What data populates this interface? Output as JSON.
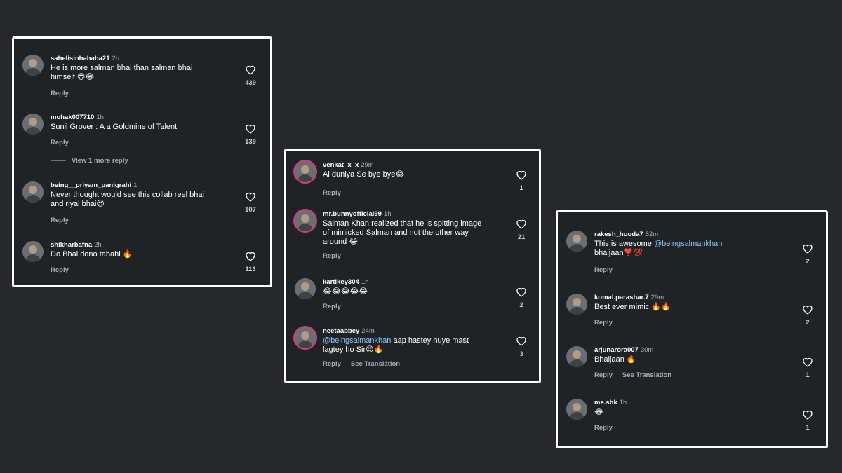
{
  "panels": [
    {
      "comments": [
        {
          "username": "sahelisinhahaha21",
          "time": "2h",
          "text": "He is more salman bhai than salman bhai himself 😍😂",
          "reply": "Reply",
          "likes": "439"
        },
        {
          "username": "mohak007710",
          "time": "1h",
          "text": "Sunil Grover : A a Goldmine of Talent",
          "reply": "Reply",
          "likes": "139",
          "more_replies": "View 1 more reply"
        },
        {
          "username": "being__priyam_panigrahi",
          "time": "1h",
          "text": "Never thought would see this collab reel bhai and riyal bhai😍",
          "reply": "Reply",
          "likes": "107"
        },
        {
          "username": "shikharbafna",
          "time": "2h",
          "text": "Do Bhai dono tabahi 🔥",
          "reply": "Reply",
          "likes": "113"
        }
      ]
    },
    {
      "comments": [
        {
          "username": "venkat_x_x",
          "time": "29m",
          "text": "Al duniya Se bye bye😂",
          "reply": "Reply",
          "likes": "1"
        },
        {
          "username": "mr.bunnyofficial99",
          "time": "1h",
          "text": "Salman Khan realized that he is spitting image of mimicked Salman and not the other way around 😂",
          "reply": "Reply",
          "likes": "21"
        },
        {
          "username": "kartikey304",
          "time": "1h",
          "text": "😂😂😂😂😂",
          "reply": "Reply",
          "likes": "2"
        },
        {
          "username": "neetaabbey",
          "time": "24m",
          "mention": "@beingsalmankhan",
          "text": " aap hastey huye mast lagtey ho Sir😍🔥",
          "reply": "Reply",
          "see_translation": "See Translation",
          "likes": "3"
        }
      ]
    },
    {
      "comments": [
        {
          "username": "rakesh_hooda7",
          "time": "52m",
          "text": "This is awesome ",
          "mention": "@beingsalmankhan",
          "text_after": " bhaijaan❣️💯",
          "reply": "Reply",
          "likes": "2"
        },
        {
          "username": "komal.parashar.7",
          "time": "29m",
          "text": "Best ever mimic 🔥🔥",
          "reply": "Reply",
          "likes": "2"
        },
        {
          "username": "arjunarora007",
          "time": "30m",
          "text": "Bhaijaan 🔥",
          "reply": "Reply",
          "see_translation": "See Translation",
          "likes": "1"
        },
        {
          "username": "me.sbk",
          "time": "1h",
          "text": "😂",
          "reply": "Reply",
          "likes": "1"
        }
      ]
    }
  ],
  "icons": {
    "like": "heart-outline-icon",
    "avatar": "user-avatar"
  },
  "colors": {
    "background": "#26282b",
    "panel": "#1f2326",
    "mention": "#8fc3f7",
    "border": "#ffffff"
  }
}
